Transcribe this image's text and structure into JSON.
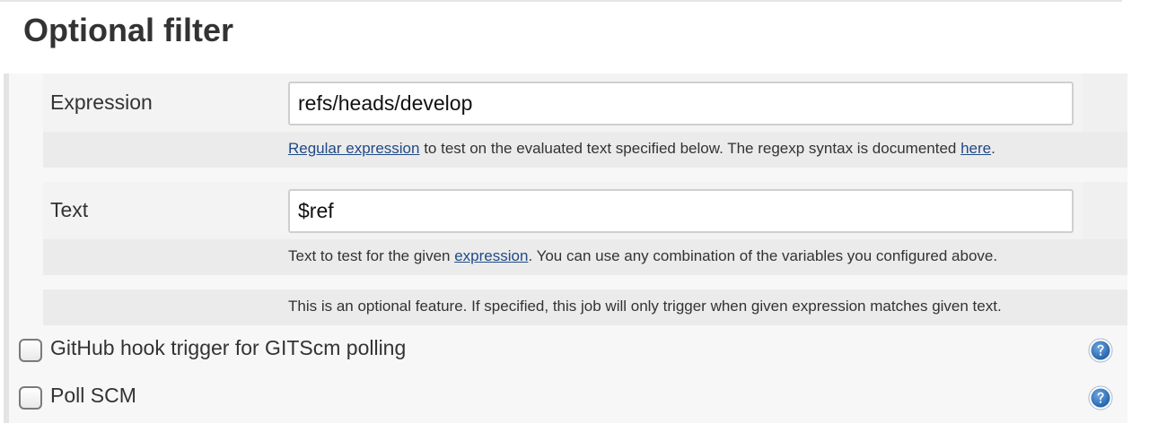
{
  "section": {
    "title": "Optional filter"
  },
  "expression": {
    "label": "Expression",
    "value": "refs/heads/develop",
    "help": {
      "link1": "Regular expression",
      "text1": " to test on the evaluated text specified below. The regexp syntax is documented ",
      "link2": "here",
      "text2": "."
    }
  },
  "text_field": {
    "label": "Text",
    "value": "$ref",
    "help": {
      "text1": "Text to test for the given ",
      "link1": "expression",
      "text2": ". You can use any combination of the variables you configured above."
    }
  },
  "optional_note": "This is an optional feature. If specified, this job will only trigger when given expression matches given text.",
  "triggers": [
    {
      "label": "GitHub hook trigger for GITScm polling",
      "checked": false,
      "help_icon": "question-mark-icon"
    },
    {
      "label": "Poll SCM",
      "checked": false,
      "help_icon": "question-mark-icon"
    }
  ],
  "colors": {
    "link": "#204a87",
    "help_icon": "#1e5fa8"
  }
}
